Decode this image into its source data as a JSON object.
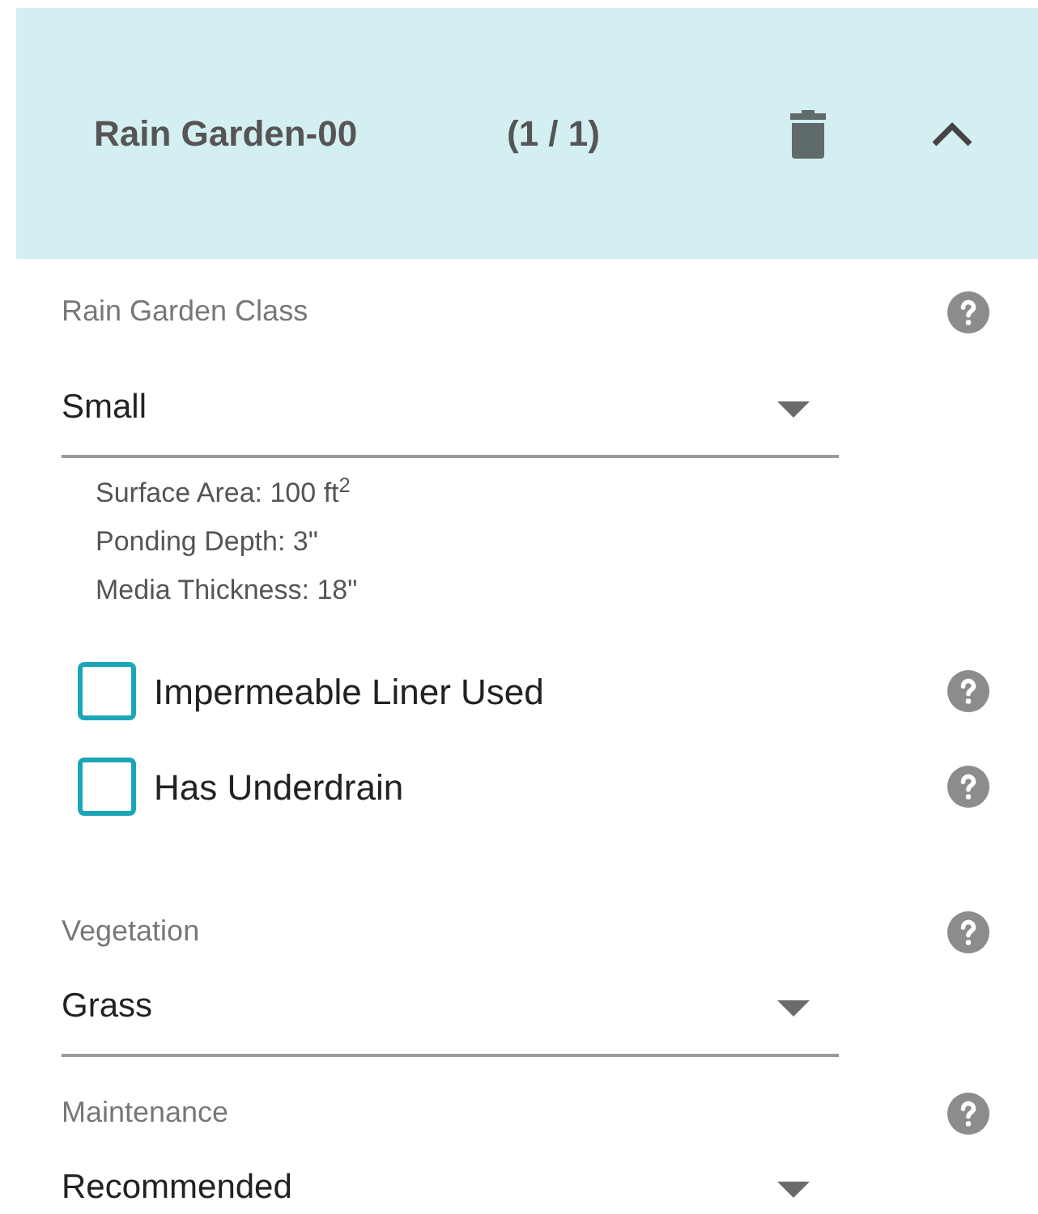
{
  "header": {
    "title": "Rain Garden-00",
    "counter": "(1 / 1)",
    "expanded": true
  },
  "fields": [
    {
      "kind": "select",
      "label": "Rain Garden Class",
      "value": "Small",
      "details": [
        "Surface Area: 100 ft$^{2}$",
        "Ponding Depth: 3\"",
        "Media Thickness: 18\""
      ]
    },
    {
      "kind": "checkbox",
      "label": "Impermeable Liner Used",
      "checked": false
    },
    {
      "kind": "checkbox",
      "label": "Has Underdrain",
      "checked": false
    },
    {
      "kind": "select",
      "label": "Vegetation",
      "value": "Grass"
    },
    {
      "kind": "select",
      "label": "Maintenance",
      "value": "Recommended"
    }
  ]
}
